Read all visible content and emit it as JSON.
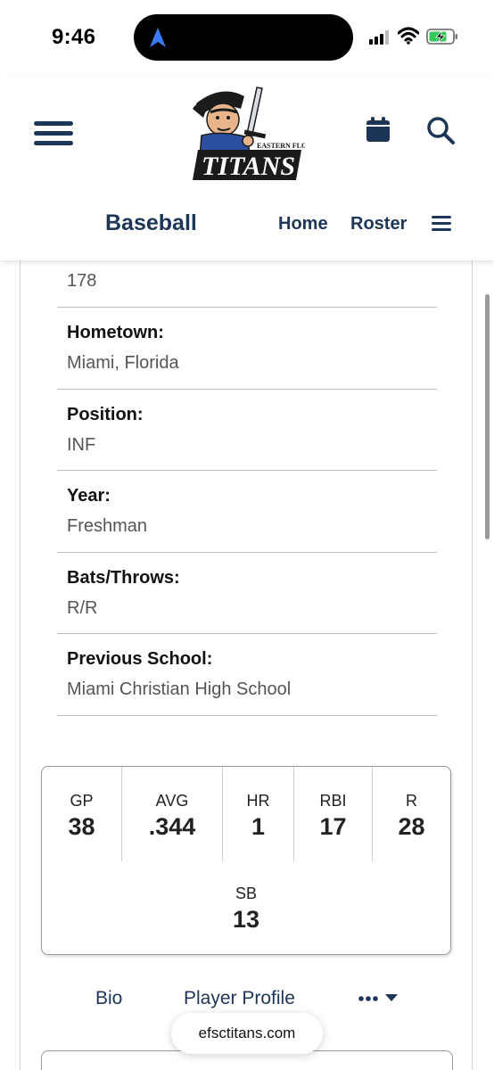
{
  "status_bar": {
    "time": "9:46",
    "icons": [
      "location-arrow-icon",
      "signal-icon",
      "wifi-icon",
      "battery-charging-icon"
    ]
  },
  "header": {
    "logo_text": "EASTERN FLORIDA TITANS",
    "menu_icon": "hamburger-icon",
    "calendar_icon": "calendar-icon",
    "search_icon": "search-icon"
  },
  "subnav": {
    "title": "Baseball",
    "links": [
      "Home",
      "Roster"
    ],
    "menu_icon": "hamburger-icon"
  },
  "details": [
    {
      "label": "",
      "value": "178"
    },
    {
      "label": "Hometown:",
      "value": "Miami, Florida"
    },
    {
      "label": "Position:",
      "value": "INF"
    },
    {
      "label": "Year:",
      "value": "Freshman"
    },
    {
      "label": "Bats/Throws:",
      "value": "R/R"
    },
    {
      "label": "Previous School:",
      "value": "Miami Christian High School"
    }
  ],
  "stats": [
    {
      "label": "GP",
      "value": "38"
    },
    {
      "label": "AVG",
      "value": ".344"
    },
    {
      "label": "HR",
      "value": "1"
    },
    {
      "label": "RBI",
      "value": "17"
    },
    {
      "label": "R",
      "value": "28"
    },
    {
      "label": "SB",
      "value": "13"
    }
  ],
  "tabs": {
    "bio": "Bio",
    "profile": "Player Profile",
    "more_icon": "more-dots-icon"
  },
  "url": "efsctitans.com",
  "colors": {
    "brand_navy": "#1d3557",
    "text_gray": "#555555",
    "divider": "#bdbdbd"
  }
}
